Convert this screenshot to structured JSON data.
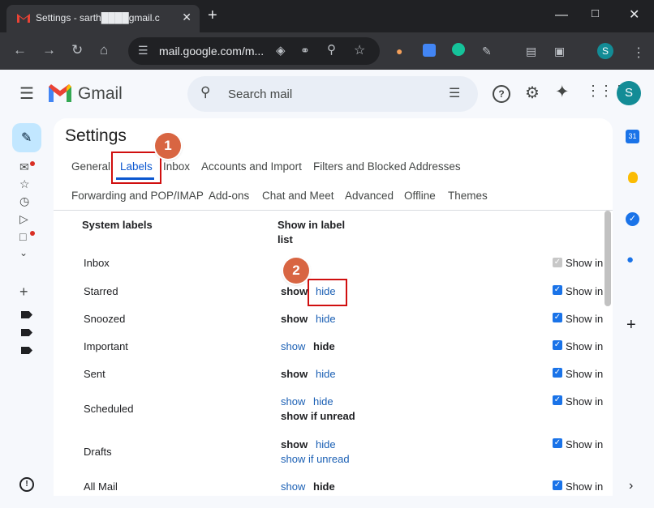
{
  "browser": {
    "tab_title": "Settings - sarth████gmail.c",
    "tab_close": "✕",
    "new_tab": "+",
    "url": "mail.google.com/m...",
    "profile_initial": "S"
  },
  "gmail": {
    "brand": "Gmail",
    "search_placeholder": "Search mail",
    "avatar_initial": "S"
  },
  "settings": {
    "title": "Settings",
    "tabs_row1": [
      "General",
      "Labels",
      "Inbox",
      "Accounts and Import",
      "Filters and Blocked Addresses"
    ],
    "tabs_row2": [
      "Forwarding and POP/IMAP",
      "Add-ons",
      "Chat and Meet",
      "Advanced",
      "Offline",
      "Themes"
    ],
    "active_tab": "Labels",
    "col_system_labels": "System labels",
    "col_show_line1": "Show in label",
    "col_show_line2": "list",
    "show_in": "Show in",
    "rows": [
      {
        "label": "Inbox"
      },
      {
        "label": "Starred",
        "opt1": "show",
        "opt2": "hide"
      },
      {
        "label": "Snoozed",
        "opt1": "show",
        "opt2": "hide"
      },
      {
        "label": "Important",
        "opt1": "show",
        "opt2": "hide"
      },
      {
        "label": "Sent",
        "opt1": "show",
        "opt2": "hide"
      },
      {
        "label": "Scheduled",
        "opt1": "show",
        "opt2": "hide",
        "opt3": "show if unread"
      },
      {
        "label": "Drafts",
        "opt1": "show",
        "opt2": "hide",
        "opt3": "show if unread"
      },
      {
        "label": "All Mail",
        "opt1": "show",
        "opt2": "hide"
      }
    ]
  },
  "annotations": {
    "badge1": "1",
    "badge2": "2",
    "badge_color": "#d86542",
    "box_color": "#d00f0f"
  },
  "colors": {
    "accent": "#0b57d0",
    "link": "#1a5fb4",
    "avatar": "#138c96"
  }
}
